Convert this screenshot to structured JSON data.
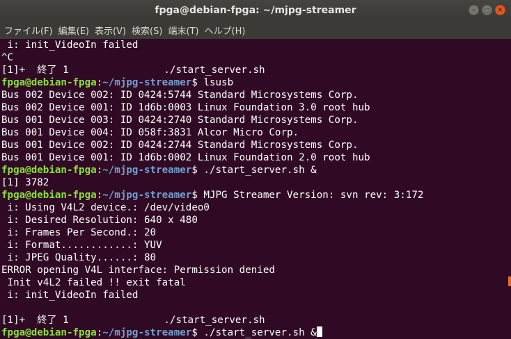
{
  "window": {
    "title": "fpga@debian-fpga: ~/mjpg-streamer",
    "controls": {
      "minimize": "–",
      "maximize": "□",
      "close": "×"
    }
  },
  "menu": [
    "ファイル(F)",
    "編集(E)",
    "表示(V)",
    "検索(S)",
    "端末(T)",
    "ヘルプ(H)"
  ],
  "prompt": {
    "user": "fpga@debian-fpga",
    "sep": ":",
    "path": "~/mjpg-streamer",
    "sym": "$"
  },
  "terminal": {
    "lines": [
      {
        "t": "text",
        "text": " i: init_VideoIn failed"
      },
      {
        "t": "text",
        "text": "^C"
      },
      {
        "t": "text",
        "text": "[1]+  終了 1                ./start_server.sh"
      },
      {
        "t": "prompt",
        "cmd": " lsusb"
      },
      {
        "t": "text",
        "text": "Bus 002 Device 002: ID 0424:5744 Standard Microsystems Corp."
      },
      {
        "t": "text",
        "text": "Bus 002 Device 001: ID 1d6b:0003 Linux Foundation 3.0 root hub"
      },
      {
        "t": "text",
        "text": "Bus 001 Device 003: ID 0424:2740 Standard Microsystems Corp."
      },
      {
        "t": "text",
        "text": "Bus 001 Device 004: ID 058f:3831 Alcor Micro Corp."
      },
      {
        "t": "text",
        "text": "Bus 001 Device 002: ID 0424:2744 Standard Microsystems Corp."
      },
      {
        "t": "text",
        "text": "Bus 001 Device 001: ID 1d6b:0002 Linux Foundation 2.0 root hub"
      },
      {
        "t": "prompt",
        "cmd": " ./start_server.sh &"
      },
      {
        "t": "text",
        "text": "[1] 3782"
      },
      {
        "t": "prompt",
        "cmd": " MJPG Streamer Version: svn rev: 3:172"
      },
      {
        "t": "text",
        "text": " i: Using V4L2 device.: /dev/video0"
      },
      {
        "t": "text",
        "text": " i: Desired Resolution: 640 x 480"
      },
      {
        "t": "text",
        "text": " i: Frames Per Second.: 20"
      },
      {
        "t": "text",
        "text": " i: Format............: YUV"
      },
      {
        "t": "text",
        "text": " i: JPEG Quality......: 80"
      },
      {
        "t": "text",
        "text": "ERROR opening V4L interface: Permission denied"
      },
      {
        "t": "text",
        "text": " Init v4L2 failed !! exit fatal"
      },
      {
        "t": "text",
        "text": " i: init_VideoIn failed"
      },
      {
        "t": "text",
        "text": ""
      },
      {
        "t": "text",
        "text": "[1]+  終了 1                ./start_server.sh"
      },
      {
        "t": "prompt",
        "cmd": " ./start_server.sh &"
      }
    ]
  }
}
